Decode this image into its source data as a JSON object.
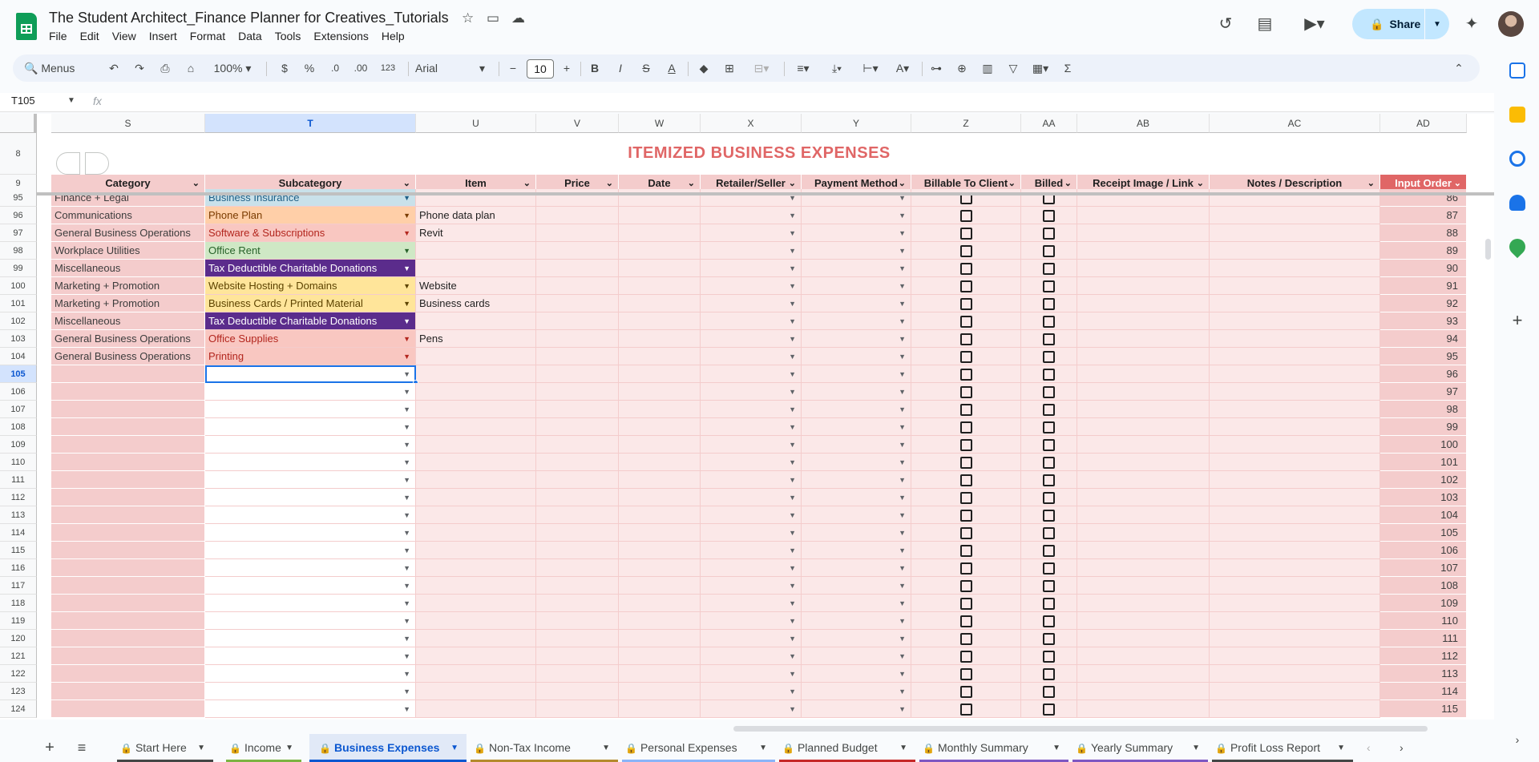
{
  "doc": {
    "title": "The Student Architect_Finance Planner for Creatives_Tutorials",
    "menu": [
      "File",
      "Edit",
      "View",
      "Insert",
      "Format",
      "Data",
      "Tools",
      "Extensions",
      "Help"
    ],
    "share_label": "Share"
  },
  "toolbar": {
    "search_label": "Menus",
    "zoom": "100%",
    "currency": "$",
    "percent": "%",
    "dec_minus": ".0",
    "dec_plus": ".00",
    "number_fmt": "123",
    "font": "Arial",
    "font_size": "10",
    "bold": "B",
    "italic": "I",
    "strike": "S",
    "textcolor": "A"
  },
  "formula": {
    "namebox": "T105",
    "fx": "fx"
  },
  "columns": [
    "S",
    "T",
    "U",
    "V",
    "W",
    "X",
    "Y",
    "Z",
    "AA",
    "AB",
    "AC",
    "AD"
  ],
  "sheet_title": "ITEMIZED BUSINESS EXPENSES",
  "headers": [
    "Category",
    "Subcategory",
    "Item",
    "Price",
    "Date",
    "Retailer/Seller",
    "Payment Method",
    "Billable To Client",
    "Billed",
    "Receipt Image / Link",
    "Notes / Description",
    "Input Order"
  ],
  "frozen_rows": [
    "8",
    "9"
  ],
  "rows": [
    {
      "row": "95",
      "cat": "Finance + Legal",
      "sub": "Business Insurance",
      "sub_style": "blue",
      "item": "",
      "order": "86"
    },
    {
      "row": "96",
      "cat": "Communications",
      "sub": "Phone Plan",
      "sub_style": "orange",
      "item": "Phone data plan",
      "order": "87"
    },
    {
      "row": "97",
      "cat": "General Business Operations",
      "sub": "Software & Subscriptions",
      "sub_style": "red",
      "item": "Revit",
      "order": "88"
    },
    {
      "row": "98",
      "cat": "Workplace Utilities",
      "sub": "Office Rent",
      "sub_style": "green",
      "item": "",
      "order": "89"
    },
    {
      "row": "99",
      "cat": "Miscellaneous",
      "sub": "Tax Deductible Charitable Donations",
      "sub_style": "purple",
      "item": "",
      "order": "90"
    },
    {
      "row": "100",
      "cat": "Marketing + Promotion",
      "sub": "Website Hosting + Domains",
      "sub_style": "yellow",
      "item": "Website",
      "order": "91"
    },
    {
      "row": "101",
      "cat": "Marketing + Promotion",
      "sub": "Business Cards / Printed Material",
      "sub_style": "yellow",
      "item": "Business cards",
      "order": "92"
    },
    {
      "row": "102",
      "cat": "Miscellaneous",
      "sub": "Tax Deductible Charitable Donations",
      "sub_style": "purple",
      "item": "",
      "order": "93"
    },
    {
      "row": "103",
      "cat": "General Business Operations",
      "sub": "Office Supplies",
      "sub_style": "red",
      "item": "Pens",
      "order": "94"
    },
    {
      "row": "104",
      "cat": "General Business Operations",
      "sub": "Printing",
      "sub_style": "red",
      "item": "",
      "order": "95"
    },
    {
      "row": "105",
      "cat": "",
      "sub": "",
      "sub_style": "selected",
      "item": "",
      "order": "96"
    },
    {
      "row": "106",
      "cat": "",
      "sub": "",
      "sub_style": "empty",
      "item": "",
      "order": "97"
    },
    {
      "row": "107",
      "cat": "",
      "sub": "",
      "sub_style": "empty",
      "item": "",
      "order": "98"
    },
    {
      "row": "108",
      "cat": "",
      "sub": "",
      "sub_style": "empty",
      "item": "",
      "order": "99"
    },
    {
      "row": "109",
      "cat": "",
      "sub": "",
      "sub_style": "empty",
      "item": "",
      "order": "100"
    },
    {
      "row": "110",
      "cat": "",
      "sub": "",
      "sub_style": "empty",
      "item": "",
      "order": "101"
    },
    {
      "row": "111",
      "cat": "",
      "sub": "",
      "sub_style": "empty",
      "item": "",
      "order": "102"
    },
    {
      "row": "112",
      "cat": "",
      "sub": "",
      "sub_style": "empty",
      "item": "",
      "order": "103"
    },
    {
      "row": "113",
      "cat": "",
      "sub": "",
      "sub_style": "empty",
      "item": "",
      "order": "104"
    },
    {
      "row": "114",
      "cat": "",
      "sub": "",
      "sub_style": "empty",
      "item": "",
      "order": "105"
    },
    {
      "row": "115",
      "cat": "",
      "sub": "",
      "sub_style": "empty",
      "item": "",
      "order": "106"
    },
    {
      "row": "116",
      "cat": "",
      "sub": "",
      "sub_style": "empty",
      "item": "",
      "order": "107"
    },
    {
      "row": "117",
      "cat": "",
      "sub": "",
      "sub_style": "empty",
      "item": "",
      "order": "108"
    },
    {
      "row": "118",
      "cat": "",
      "sub": "",
      "sub_style": "empty",
      "item": "",
      "order": "109"
    },
    {
      "row": "119",
      "cat": "",
      "sub": "",
      "sub_style": "empty",
      "item": "",
      "order": "110"
    },
    {
      "row": "120",
      "cat": "",
      "sub": "",
      "sub_style": "empty",
      "item": "",
      "order": "111"
    },
    {
      "row": "121",
      "cat": "",
      "sub": "",
      "sub_style": "empty",
      "item": "",
      "order": "112"
    },
    {
      "row": "122",
      "cat": "",
      "sub": "",
      "sub_style": "empty",
      "item": "",
      "order": "113"
    },
    {
      "row": "123",
      "cat": "",
      "sub": "",
      "sub_style": "empty",
      "item": "",
      "order": "114"
    },
    {
      "row": "124",
      "cat": "",
      "sub": "",
      "sub_style": "empty",
      "item": "",
      "order": "115"
    }
  ],
  "sub_colors": {
    "blue": {
      "bg": "#c9e1ea",
      "fg": "#1f5f86"
    },
    "orange": {
      "bg": "#ffcfa8",
      "fg": "#7a3b00"
    },
    "red": {
      "bg": "#f9c7c1",
      "fg": "#b3261e"
    },
    "green": {
      "bg": "#cfe8c5",
      "fg": "#27632a"
    },
    "purple": {
      "bg": "#5b2c8c",
      "fg": "#ffffff"
    },
    "yellow": {
      "bg": "#ffe59a",
      "fg": "#5c4300"
    }
  },
  "tabs": [
    {
      "label": "Start Here",
      "color": "#444746",
      "active": false
    },
    {
      "label": "Income",
      "color": "#7cb342",
      "active": false
    },
    {
      "label": "Business Expenses",
      "color": "#0b57d0",
      "active": true
    },
    {
      "label": "Non-Tax Income",
      "color": "#b48a2c",
      "active": false
    },
    {
      "label": "Personal Expenses",
      "color": "#8ab4f8",
      "active": false
    },
    {
      "label": "Planned Budget",
      "color": "#c62828",
      "active": false
    },
    {
      "label": "Monthly Summary",
      "color": "#7e57c2",
      "active": false
    },
    {
      "label": "Yearly Summary",
      "color": "#7e57c2",
      "active": false
    },
    {
      "label": "Profit Loss Report",
      "color": "#444746",
      "active": false
    }
  ]
}
